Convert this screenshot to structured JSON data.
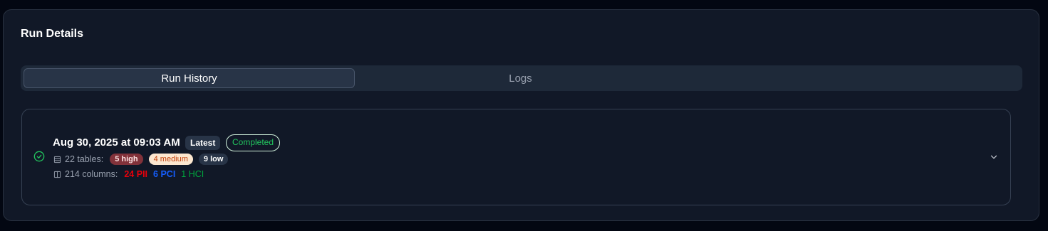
{
  "card": {
    "title": "Run Details"
  },
  "tabs": [
    {
      "label": "Run History",
      "active": true
    },
    {
      "label": "Logs",
      "active": false
    }
  ],
  "run": {
    "status_icon": "check-circle-icon",
    "date": "Aug 30, 2025 at 09:03 AM",
    "latest_badge": "Latest",
    "status_badge": "Completed",
    "tables": {
      "icon": "database-icon",
      "label": "22 tables:",
      "high": "5 high",
      "medium": "4 medium",
      "low": "9 low"
    },
    "columns": {
      "icon": "columns-icon",
      "label": "214 columns:",
      "pii": "24 PII",
      "pci": "6 PCI",
      "hci": "1 HCI"
    },
    "expand_icon": "chevron-down-icon"
  },
  "colors": {
    "background": "#030712",
    "card": "#111827",
    "success": "#22c55e",
    "pii": "#e7000b",
    "pci": "#155dfc",
    "hci": "#00a63e"
  }
}
